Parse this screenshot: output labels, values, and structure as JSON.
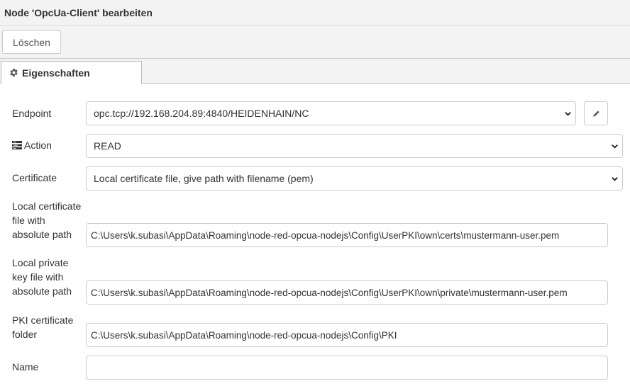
{
  "header": {
    "title": "Node 'OpcUa-Client' bearbeiten"
  },
  "toolbar": {
    "delete_label": "Löschen"
  },
  "tabs": [
    {
      "label": "Eigenschaften",
      "icon": "gear-icon"
    }
  ],
  "form": {
    "endpoint": {
      "label": "Endpoint",
      "value": "opc.tcp://192.168.204.89:4840/HEIDENHAIN/NC",
      "edit_icon": "pencil-icon"
    },
    "action": {
      "label": "Action",
      "icon": "tasks-icon",
      "value": "READ"
    },
    "certificate": {
      "label": "Certificate",
      "value": "Local certificate file, give path with filename (pem)"
    },
    "local_cert": {
      "label_lines": [
        "Local certificate",
        "file with",
        "absolute path"
      ],
      "value": "C:\\Users\\k.subasi\\AppData\\Roaming\\node-red-opcua-nodejs\\Config\\UserPKI\\own\\certs\\mustermann-user.pem"
    },
    "local_key": {
      "label_lines": [
        "Local private",
        "key file with",
        "absolute path"
      ],
      "value": "C:\\Users\\k.subasi\\AppData\\Roaming\\node-red-opcua-nodejs\\Config\\UserPKI\\own\\private\\mustermann-user.pem"
    },
    "pki_folder": {
      "label_lines": [
        "PKI certificate",
        "folder"
      ],
      "value": "C:\\Users\\k.subasi\\AppData\\Roaming\\node-red-opcua-nodejs\\Config\\PKI"
    },
    "name": {
      "label": "Name",
      "value": ""
    }
  }
}
